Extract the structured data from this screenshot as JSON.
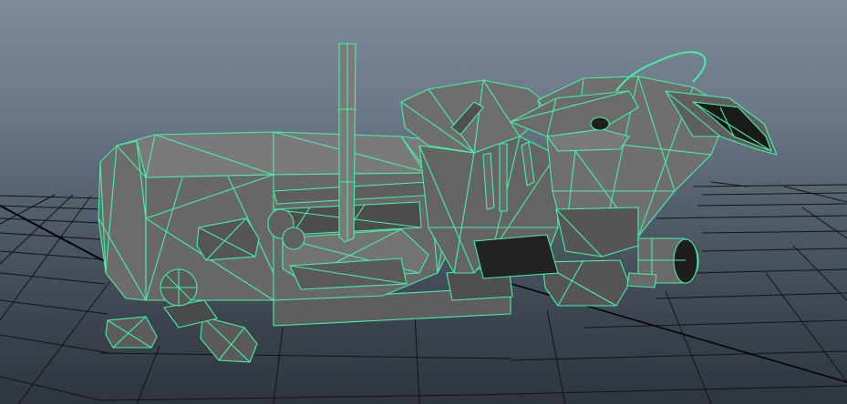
{
  "viewport": {
    "label": "",
    "background_top": "#7c8a9a",
    "background_bottom": "#2e353d"
  },
  "grid": {
    "line_color": "#111418",
    "axis_color": "#000000",
    "visible": true
  },
  "model": {
    "name": "",
    "surface_color": "#6f6f6f",
    "surface_dark": "#3a3a3a",
    "surface_light": "#8a8a8a",
    "wireframe_color": "#46f0a6",
    "display_mode": "shaded-wireframe",
    "selected": true
  }
}
